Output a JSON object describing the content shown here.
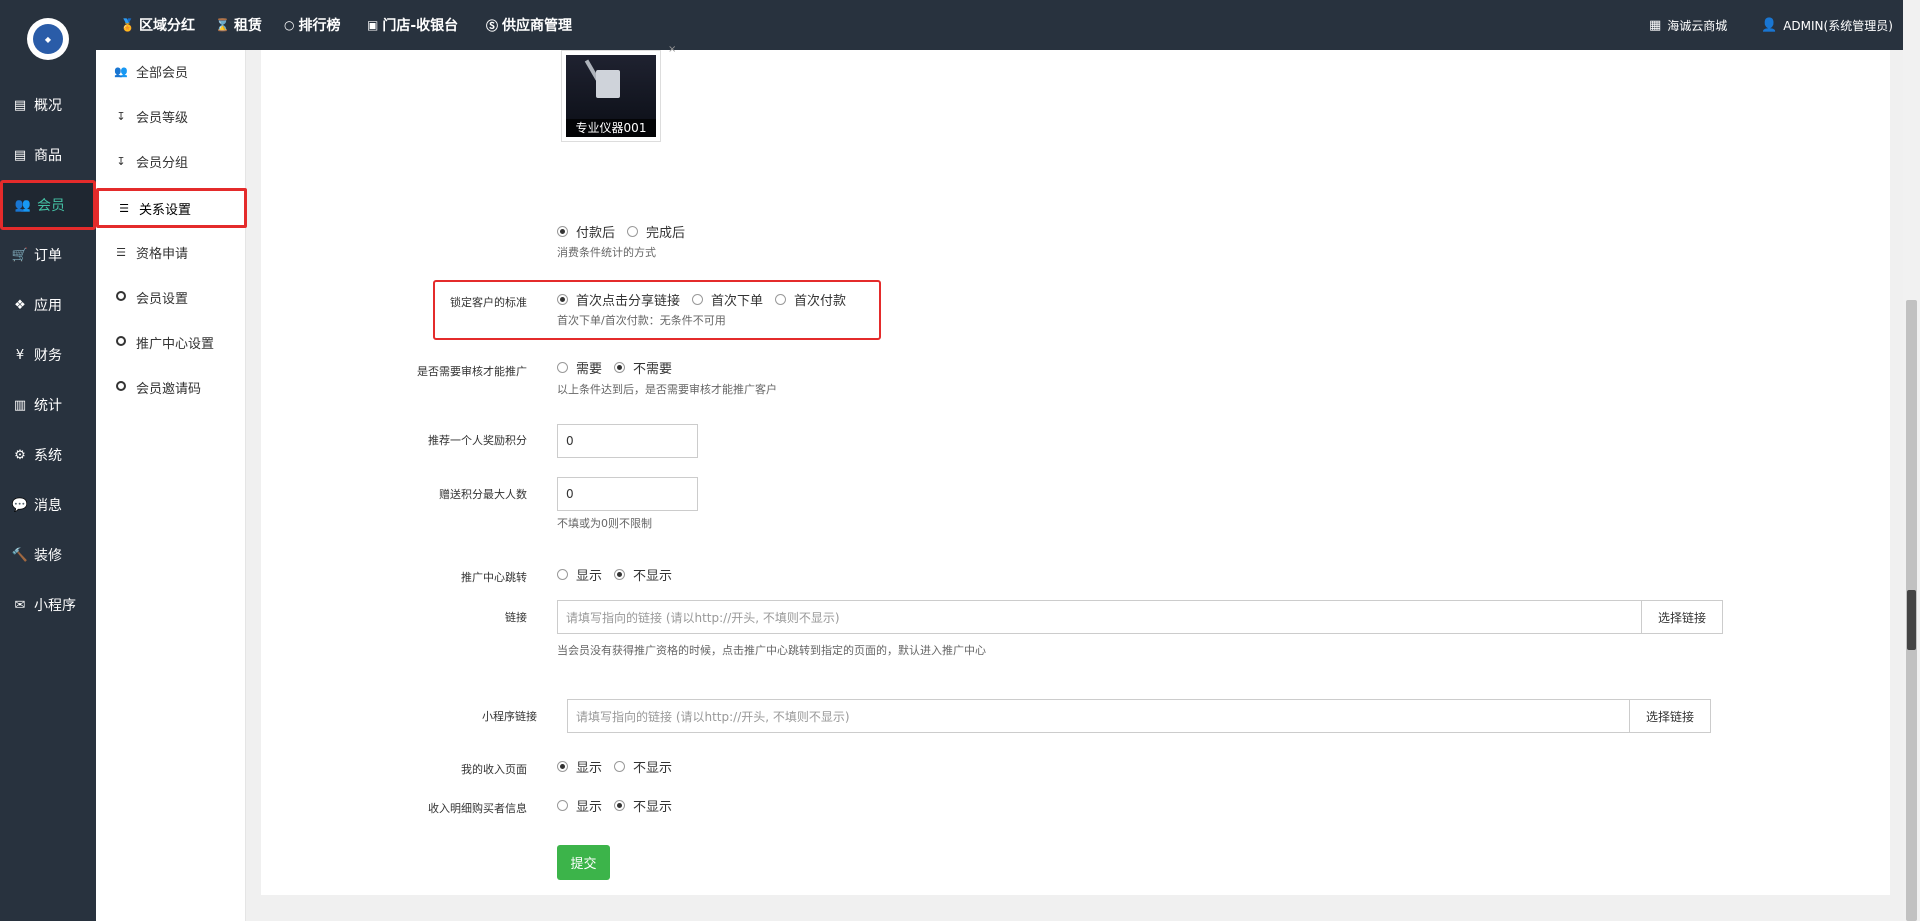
{
  "top_nav": {
    "links": [
      {
        "label": "区域分红",
        "icon": "medal-icon"
      },
      {
        "label": "租赁",
        "icon": "hourglass-icon"
      },
      {
        "label": "排行榜",
        "icon": "circle-icon"
      },
      {
        "label": "门店-收银台",
        "icon": "cash-icon"
      },
      {
        "label": "供应商管理",
        "icon": "skype-icon"
      }
    ],
    "shop_label": "海诚云商城",
    "user_label": "ADMIN(系统管理员)"
  },
  "left_nav": {
    "items": [
      {
        "label": "概况",
        "icon": "inbox-icon"
      },
      {
        "label": "商品",
        "icon": "archive-icon"
      },
      {
        "label": "会员",
        "icon": "users-icon",
        "active": true
      },
      {
        "label": "订单",
        "icon": "cart-icon"
      },
      {
        "label": "应用",
        "icon": "cubes-icon"
      },
      {
        "label": "财务",
        "icon": "yen-icon"
      },
      {
        "label": "统计",
        "icon": "bar-chart-icon"
      },
      {
        "label": "系统",
        "icon": "cogs-icon"
      },
      {
        "label": "消息",
        "icon": "comment-icon"
      },
      {
        "label": "装修",
        "icon": "gavel-icon"
      },
      {
        "label": "小程序",
        "icon": "wechat-icon"
      }
    ]
  },
  "sub_nav": {
    "items": [
      {
        "label": "全部会员",
        "icon": "users-icon"
      },
      {
        "label": "会员等级",
        "icon": "sort-amount-icon"
      },
      {
        "label": "会员分组",
        "icon": "sort-numeric-icon"
      },
      {
        "label": "关系设置",
        "icon": "sliders-icon",
        "active": true
      },
      {
        "label": "资格申请",
        "icon": "sliders-icon"
      },
      {
        "label": "会员设置",
        "icon": "circle-icon"
      },
      {
        "label": "推广中心设置",
        "icon": "circle-icon"
      },
      {
        "label": "会员邀请码",
        "icon": "circle-icon"
      }
    ]
  },
  "form": {
    "product_caption": "专业仪器001",
    "consume_options": [
      "付款后",
      "完成后"
    ],
    "consume_help": "消费条件统计的方式",
    "lock_label": "锁定客户的标准",
    "lock_options": [
      "首次点击分享链接",
      "首次下单",
      "首次付款"
    ],
    "lock_help": "首次下单/首次付款：无条件不可用",
    "audit_label": "是否需要审核才能推广",
    "audit_options": [
      "需要",
      "不需要"
    ],
    "audit_help": "以上条件达到后，是否需要审核才能推广客户",
    "reward_label": "推荐一个人奖励积分",
    "reward_value": "0",
    "max_people_label": "赠送积分最大人数",
    "max_people_value": "0",
    "max_people_help": "不填或为0则不限制",
    "jump_label": "推广中心跳转",
    "jump_options": [
      "显示",
      "不显示"
    ],
    "link_label": "链接",
    "link_placeholder": "请填写指向的链接 (请以http://开头, 不填则不显示)",
    "link_button": "选择链接",
    "link_help": "当会员没有获得推广资格的时候，点击推广中心跳转到指定的页面的，默认进入推广中心",
    "mini_link_label": "小程序链接",
    "mini_link_placeholder": "请填写指向的链接 (请以http://开头, 不填则不显示)",
    "mini_link_button": "选择链接",
    "income_label": "我的收入页面",
    "income_options": [
      "显示",
      "不显示"
    ],
    "buyer_label": "收入明细购买者信息",
    "buyer_options": [
      "显示",
      "不显示"
    ],
    "submit_label": "提交"
  }
}
